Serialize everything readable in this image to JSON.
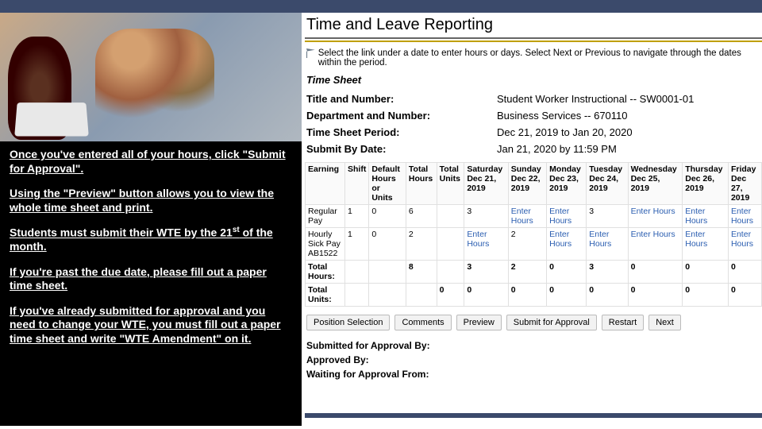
{
  "instructions": {
    "p1": "Once you've entered all of your hours, click \"Submit for Approval\".",
    "p2": "Using the \"Preview\" button allows you to view the whole time sheet and print.",
    "p3a": "Students must submit their WTE by the 21",
    "p3b": " of the month.",
    "p4": "If you're past the due date, please fill out a paper time sheet.",
    "p5": "If you've already submitted for approval and you need to change your WTE, you must fill out a paper time sheet and write \"WTE Amendment\" on it."
  },
  "page": {
    "title": "Time and Leave Reporting"
  },
  "hint": "Select the link under a date to enter hours or days. Select Next or Previous to navigate through the dates within the period.",
  "section_header": "Time Sheet",
  "meta": {
    "title_label": "Title and Number:",
    "title_value": "Student Worker Instructional -- SW0001-01",
    "dept_label": "Department and Number:",
    "dept_value": "Business Services -- 670110",
    "period_label": "Time Sheet Period:",
    "period_value": "Dec 21, 2019 to Jan 20, 2020",
    "submit_label": "Submit By Date:",
    "submit_value": "Jan 21, 2020 by 11:59 PM"
  },
  "grid": {
    "headers": [
      "Earning",
      "Shift",
      "Default Hours or Units",
      "Total Hours",
      "Total Units",
      "Saturday Dec 21, 2019",
      "Sunday Dec 22, 2019",
      "Monday Dec 23, 2019",
      "Tuesday Dec 24, 2019",
      "Wednesday Dec 25, 2019",
      "Thursday Dec 26, 2019",
      "Friday Dec 27, 2019"
    ],
    "rows": [
      {
        "label": "Regular Pay",
        "shift": "1",
        "def": "0",
        "th": "6",
        "tu": "",
        "d": [
          "3",
          "Enter Hours",
          "Enter Hours",
          "3",
          "Enter Hours",
          "Enter Hours",
          "Enter Hours"
        ]
      },
      {
        "label": "Hourly Sick Pay AB1522",
        "shift": "1",
        "def": "0",
        "th": "2",
        "tu": "",
        "d": [
          "Enter Hours",
          "2",
          "Enter Hours",
          "Enter Hours",
          "Enter Hours",
          "Enter Hours",
          "Enter Hours"
        ]
      }
    ],
    "totals": {
      "hours_label": "Total Hours:",
      "hours": [
        "8",
        "",
        "3",
        "2",
        "0",
        "3",
        "0",
        "0",
        "0"
      ],
      "units_label": "Total Units:",
      "units": [
        "",
        "0",
        "0",
        "0",
        "0",
        "0",
        "0",
        "0",
        "0"
      ]
    }
  },
  "buttons": [
    "Position Selection",
    "Comments",
    "Preview",
    "Submit for Approval",
    "Restart",
    "Next"
  ],
  "status": {
    "s1": "Submitted for Approval By:",
    "s2": "Approved By:",
    "s3": "Waiting for Approval From:"
  }
}
